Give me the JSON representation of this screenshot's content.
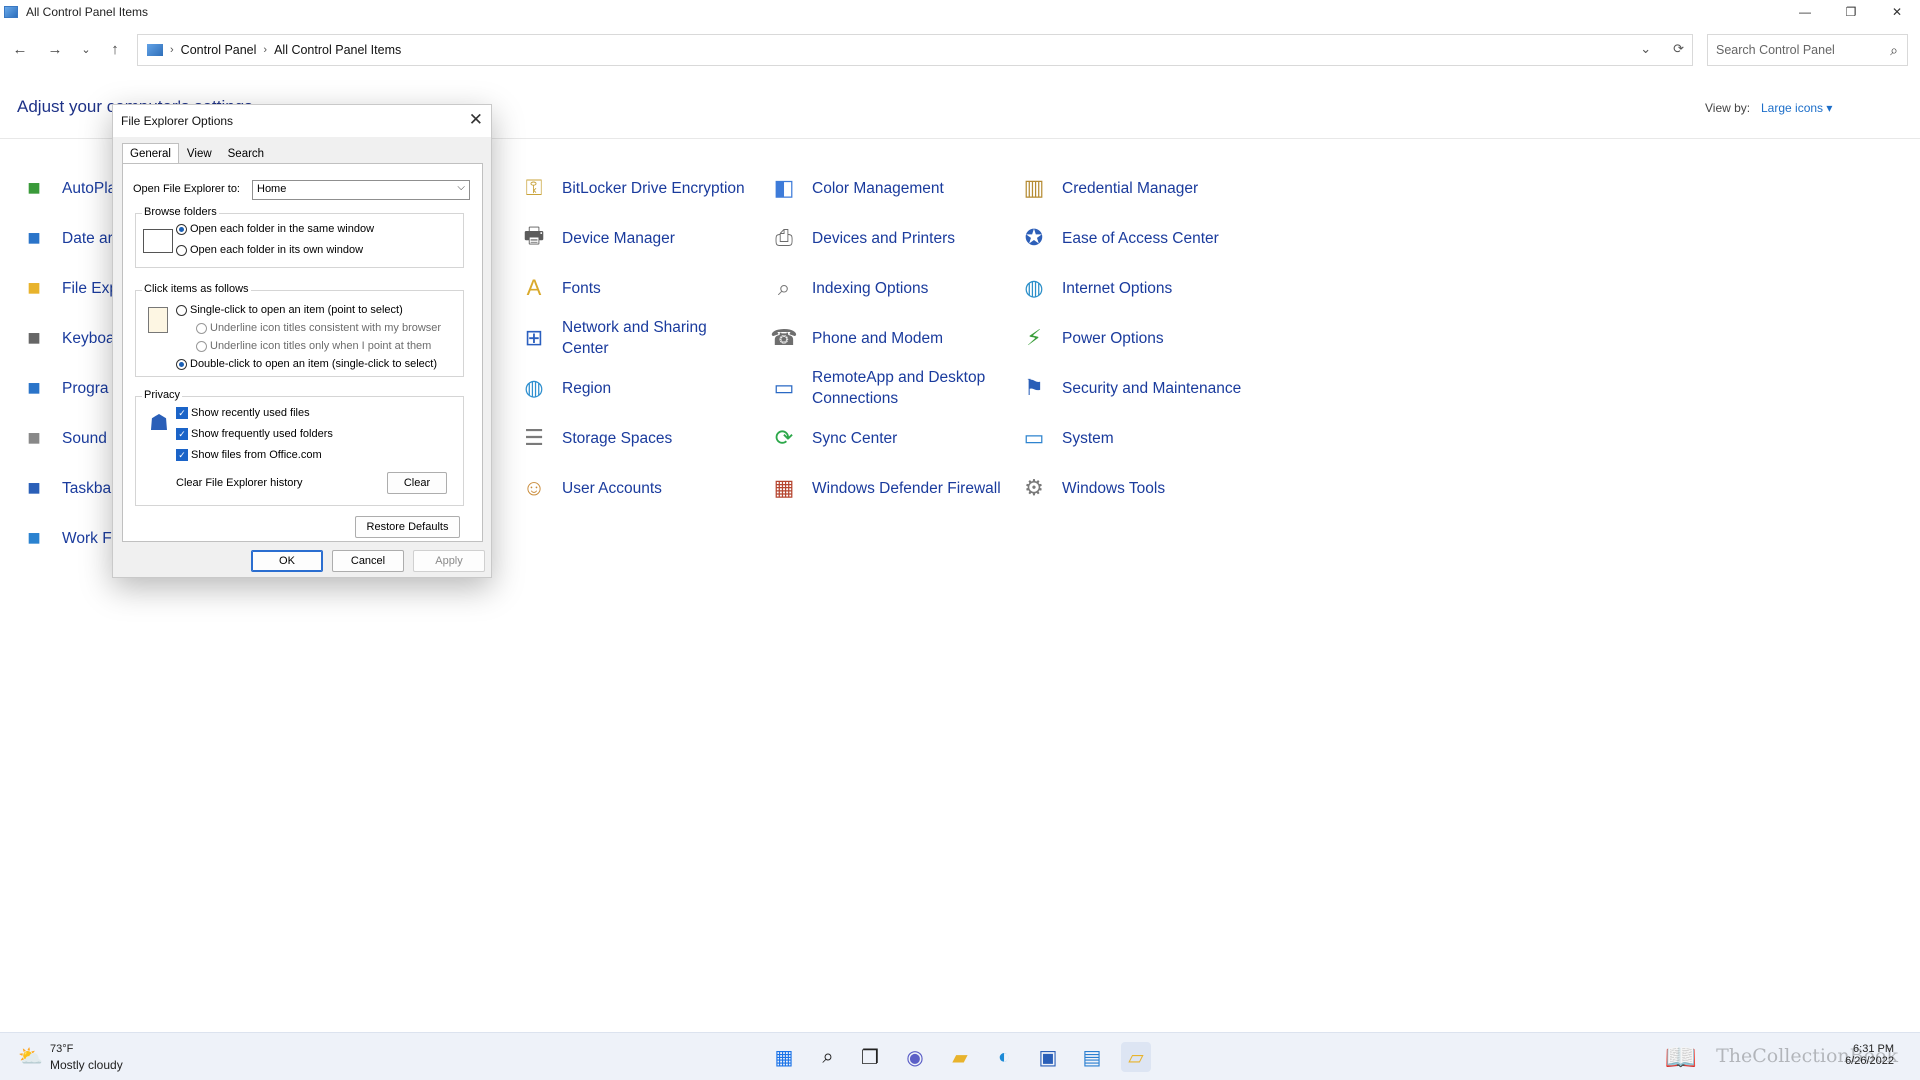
{
  "window": {
    "title": "All Control Panel Items",
    "controls": {
      "minimize": "—",
      "restore": "❐",
      "close": "✕"
    }
  },
  "address_bar": {
    "crumbs": [
      "Control Panel",
      "All Control Panel Items"
    ],
    "search_placeholder": "Search Control Panel"
  },
  "main": {
    "title": "Adjust your computer's settings",
    "view_by_label": "View by:",
    "view_by_value": "Large icons ▾",
    "left_items": [
      "AutoPla",
      "Date ar",
      "File Exp",
      "Keyboa",
      "Progra",
      "Sound",
      "Taskbar",
      "Work F"
    ],
    "items": [
      {
        "label": "BitLocker Drive Encryption",
        "icon": "key-icon",
        "color": "#c9a33a"
      },
      {
        "label": "Color Management",
        "icon": "color-management-icon",
        "color": "#3d7bd9"
      },
      {
        "label": "Credential Manager",
        "icon": "vault-icon",
        "color": "#b58b32"
      },
      {
        "label": "Device Manager",
        "icon": "device-manager-icon",
        "color": "#5b5b5b"
      },
      {
        "label": "Devices and Printers",
        "icon": "printer-icon",
        "color": "#6b6b6b"
      },
      {
        "label": "Ease of Access Center",
        "icon": "ease-of-access-icon",
        "color": "#2d5fb8"
      },
      {
        "label": "Fonts",
        "icon": "fonts-icon",
        "color": "#d9a92b"
      },
      {
        "label": "Indexing Options",
        "icon": "indexing-icon",
        "color": "#777777"
      },
      {
        "label": "Internet Options",
        "icon": "globe-icon",
        "color": "#2b8fc9"
      },
      {
        "label": "Network and Sharing Center",
        "icon": "network-icon",
        "color": "#2b5fbf"
      },
      {
        "label": "Phone and Modem",
        "icon": "phone-icon",
        "color": "#6e6e6e"
      },
      {
        "label": "Power Options",
        "icon": "power-icon",
        "color": "#3b9f3b"
      },
      {
        "label": "Region",
        "icon": "region-icon",
        "color": "#2e8fcf"
      },
      {
        "label": "RemoteApp and Desktop Connections",
        "icon": "remote-desktop-icon",
        "color": "#2a69c4"
      },
      {
        "label": "Security and Maintenance",
        "icon": "flag-icon",
        "color": "#2a5fb8"
      },
      {
        "label": "Storage Spaces",
        "icon": "storage-icon",
        "color": "#7a7a7a"
      },
      {
        "label": "Sync Center",
        "icon": "sync-icon",
        "color": "#2da84a"
      },
      {
        "label": "System",
        "icon": "system-icon",
        "color": "#2e84cf"
      },
      {
        "label": "User Accounts",
        "icon": "users-icon",
        "color": "#c98b3a"
      },
      {
        "label": "Windows Defender Firewall",
        "icon": "firewall-icon",
        "color": "#b5452f"
      },
      {
        "label": "Windows Tools",
        "icon": "gears-icon",
        "color": "#7a7a7a"
      }
    ]
  },
  "dialog": {
    "title": "File Explorer Options",
    "tabs": [
      "General",
      "View",
      "Search"
    ],
    "open_to_label": "Open File Explorer to:",
    "open_to_value": "Home",
    "browse_folders": {
      "legend": "Browse folders",
      "opt_same": "Open each folder in the same window",
      "opt_own": "Open each folder in its own window"
    },
    "click_items": {
      "legend": "Click items as follows",
      "single": "Single-click to open an item (point to select)",
      "underline_browser": "Underline icon titles consistent with my browser",
      "underline_point": "Underline icon titles only when I point at them",
      "double": "Double-click to open an item (single-click to select)"
    },
    "privacy": {
      "legend": "Privacy",
      "recent_files": "Show recently used files",
      "frequent_folders": "Show frequently used folders",
      "office_files": "Show files from Office.com",
      "clear_label": "Clear File Explorer history",
      "clear_button": "Clear"
    },
    "restore_defaults": "Restore Defaults",
    "ok": "OK",
    "cancel": "Cancel",
    "apply": "Apply"
  },
  "taskbar": {
    "weather_temp": "73°F",
    "weather_cond": "Mostly cloudy",
    "time": "6:31 PM",
    "date": "6/26/2022",
    "watermark": "TheCollectionBook"
  }
}
